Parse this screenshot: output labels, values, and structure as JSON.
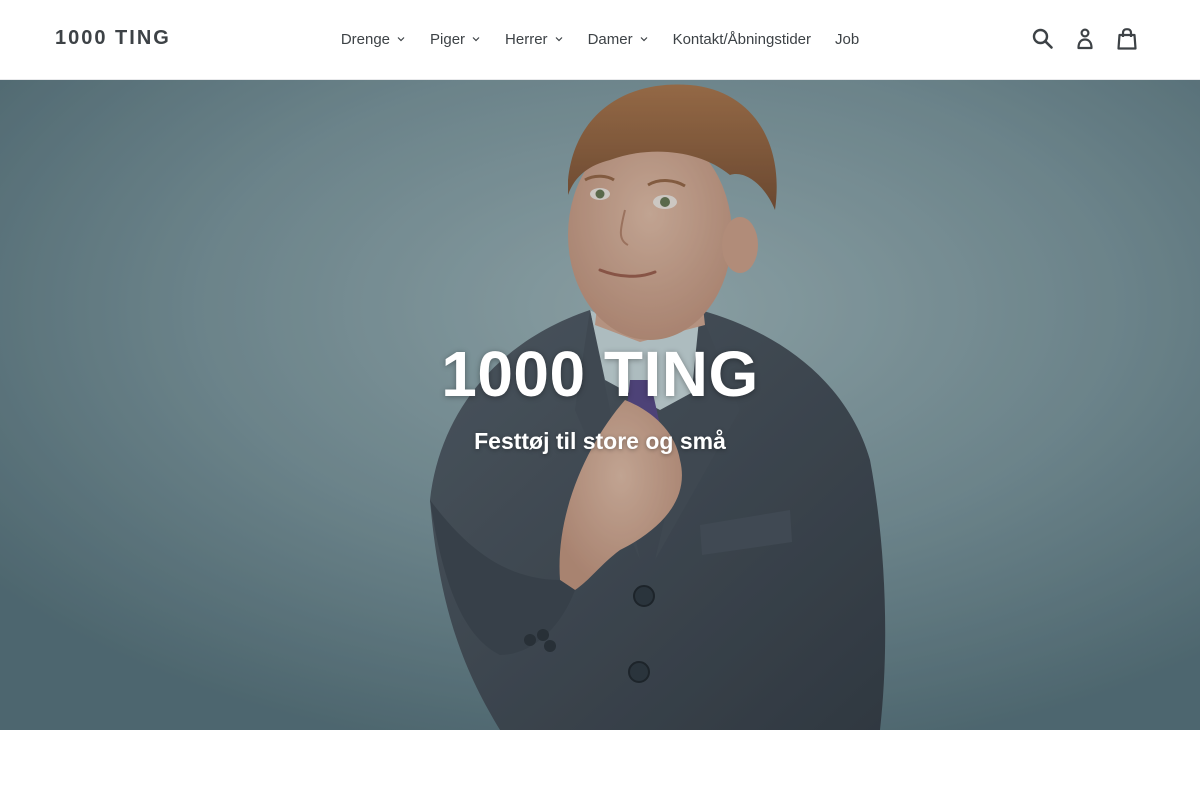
{
  "header": {
    "logo": "1000 TING",
    "nav": [
      {
        "label": "Drenge",
        "dropdown": true
      },
      {
        "label": "Piger",
        "dropdown": true
      },
      {
        "label": "Herrer",
        "dropdown": true
      },
      {
        "label": "Damer",
        "dropdown": true
      },
      {
        "label": "Kontakt/Åbningstider",
        "dropdown": false
      },
      {
        "label": "Job",
        "dropdown": false
      }
    ],
    "icons": [
      "search-icon",
      "account-icon",
      "cart-icon"
    ]
  },
  "hero": {
    "title": "1000 TING",
    "subtitle": "Festtøj til store og små",
    "image": "boy-in-grey-suit-adjusting-tie"
  },
  "colors": {
    "text": "#3d4246",
    "hero_bg": "#6f8c94",
    "white": "#ffffff"
  }
}
